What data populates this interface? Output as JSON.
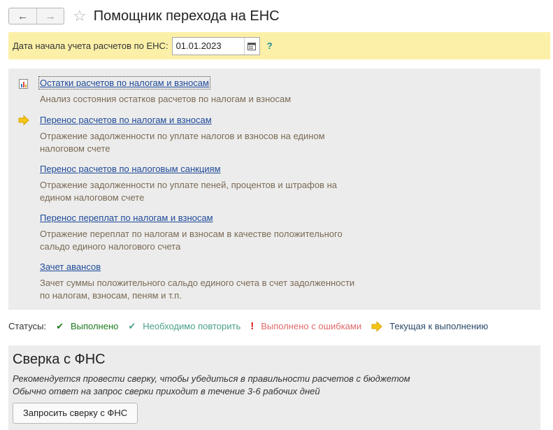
{
  "window": {
    "title": "Помощник перехода на ЕНС",
    "back_glyph": "←",
    "forward_glyph": "→",
    "favorite_glyph": "☆"
  },
  "datebar": {
    "label": "Дата начала учета расчетов по ЕНС:",
    "date_value": "01.01.2023",
    "help": "?"
  },
  "steps": [
    {
      "link": "Остатки расчетов по налогам и взносам",
      "desc": "Анализ состояния остатков расчетов по налогам и взносам",
      "icon": "report-icon"
    },
    {
      "link": "Перенос расчетов по налогам и взносам",
      "desc": "Отражение задолженности по уплате налогов и взносов на едином налоговом счете",
      "icon": "current-arrow-icon"
    },
    {
      "link": "Перенос расчетов по налоговым санкциям",
      "desc": "Отражение задолженности по уплате пеней, процентов и штрафов на едином налоговом счете",
      "icon": ""
    },
    {
      "link": "Перенос переплат по налогам и взносам",
      "desc": "Отражение переплат по налогам и взносам в качестве положительного сальдо единого налогового счета",
      "icon": ""
    },
    {
      "link": "Зачет авансов",
      "desc": "Зачет суммы положительного сальдо единого счета в счет задолженности по налогам, взносам, пеням и т.п.",
      "icon": ""
    }
  ],
  "statuses": {
    "label": "Статусы:",
    "items": [
      {
        "mark": "✔",
        "text": "Выполнено",
        "color": "#1f7a1f"
      },
      {
        "mark": "✔",
        "text": "Необходимо повторить",
        "color": "#4aa08a"
      },
      {
        "mark": "!",
        "text": "Выполнено с ошибками",
        "color": "#e06a6a"
      },
      {
        "mark": "arrow",
        "text": "Текущая к выполнению",
        "color": "#2a4a6a"
      }
    ]
  },
  "reconciliation": {
    "title": "Сверка с ФНС",
    "note_line1": "Рекомендуется провести сверку, чтобы убедиться в правильности расчетов с бюджетом",
    "note_line2": "Обычно ответ на запрос сверки приходит в течение 3-6 рабочих дней",
    "button": "Запросить сверку с ФНС"
  },
  "colors": {
    "date_bar_bg": "#fcf0a8",
    "link": "#1e4a99",
    "description": "#7a6a55",
    "arrow_icon": "#f5c518"
  }
}
